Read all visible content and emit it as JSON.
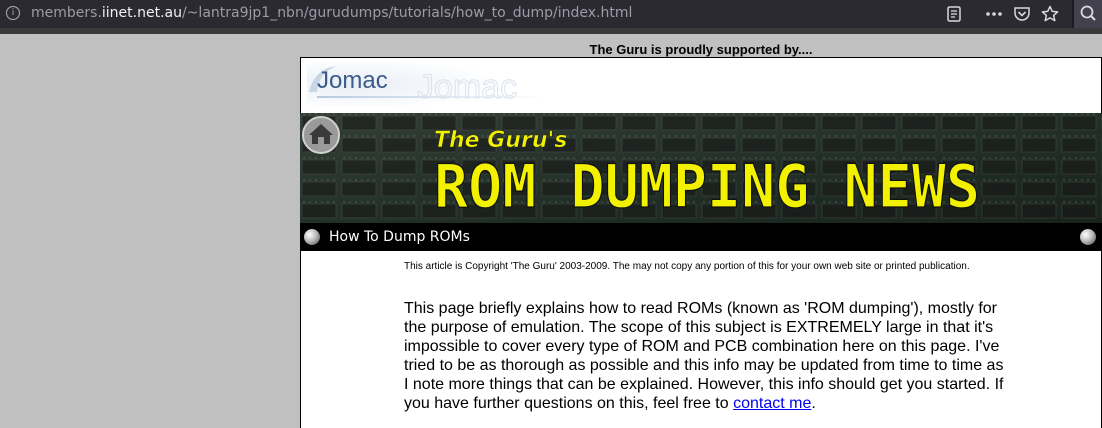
{
  "browser": {
    "url_prefix": "members.",
    "url_domain": "iinet.net.au",
    "url_path": "/~lantra9jp1_nbn/gurudumps/tutorials/how_to_dump/index.html",
    "icons": [
      "info-icon",
      "reader-view-icon",
      "more-icon",
      "pocket-icon",
      "bookmark-star-icon",
      "search-icon"
    ]
  },
  "page": {
    "supported_text": "The Guru is proudly supported by....",
    "sponsor": {
      "logo_text": "Jomac",
      "logo_echo": "Jomac"
    },
    "banner": {
      "subtitle": "The Guru's",
      "title": "ROM DUMPING NEWS"
    },
    "section_title": "How To Dump ROMs",
    "copyright": "This article is Copyright 'The Guru' 2003-2009. The may not copy any portion of this for your own web site or printed publication.",
    "intro_text": "This page briefly explains how to read ROMs (known as 'ROM dumping'), mostly for the purpose of emulation. The scope of this subject is EXTREMELY large in that it's impossible to cover every type of ROM and PCB combination here on this page. I've tried to be as thorough as possible and this info may be updated from time to time as I note more things that can be explained. However, this info should get you started. If you have further questions on this, feel free to",
    "contact_link": "contact me",
    "intro_end": "."
  }
}
